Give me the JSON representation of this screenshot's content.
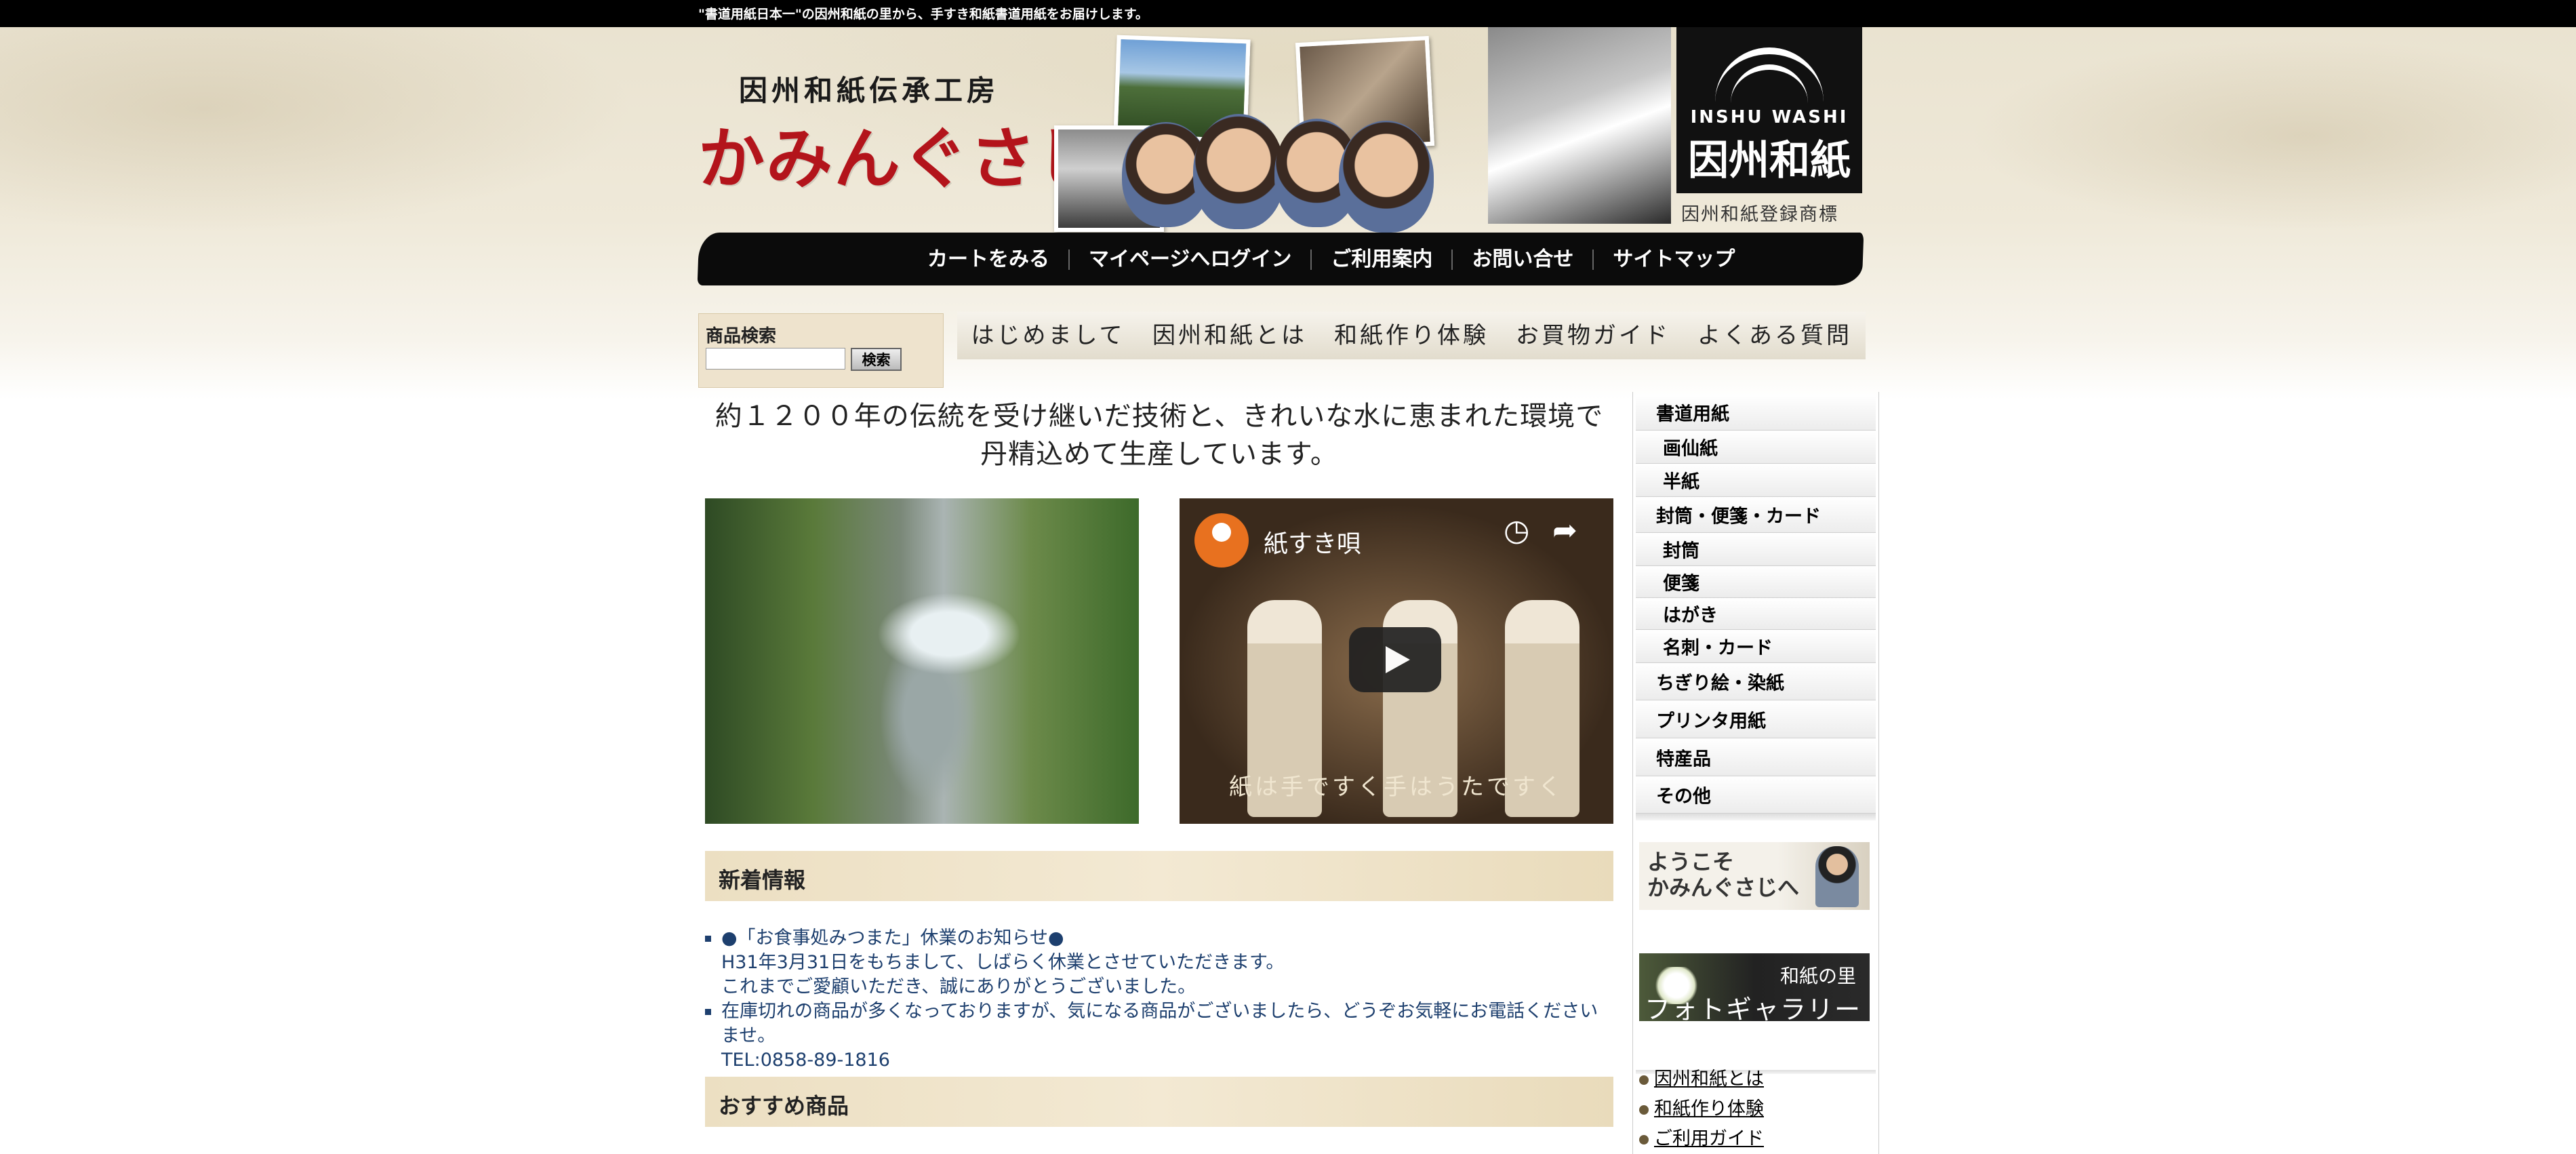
{
  "topbar": {
    "text": "\"書道用紙日本一\"の因州和紙の里から、手すき和紙書道用紙をお届けします。"
  },
  "header": {
    "logo_sub": "因州和紙伝承工房",
    "logo_main": "かみんぐさじ",
    "brand_en": "INSHU WASHI",
    "brand_jp": "因州和紙",
    "brand_caption": "因州和紙登録商標"
  },
  "nav": {
    "items": [
      "カートをみる",
      "マイページへログイン",
      "ご利用案内",
      "お問い合せ",
      "サイトマップ"
    ]
  },
  "search": {
    "title": "商品検索",
    "value": "",
    "button": "検索"
  },
  "tabs": [
    "はじめまして",
    "因州和紙とは",
    "和紙作り体験",
    "お買物ガイド",
    "よくある質問"
  ],
  "main": {
    "tagline_line1": "約１２００年の伝統を受け継いだ技術と、きれいな水に恵まれた環境で",
    "tagline_line2": "丹精込めて生産しています。",
    "video": {
      "title": "紙すき唄",
      "caption": "紙は手ですく手はうたですく"
    },
    "news_heading": "新着情報",
    "news": [
      "●「お食事処みつまた」休業のお知らせ●",
      "H31年3月31日をもちまして、しばらく休業とさせていただきます。",
      "これまでご愛顧いただき、誠にありがとうございました。",
      "在庫切れの商品が多くなっておりますが、気になる商品がございましたら、どうぞお気軽にお電話くださいませ。",
      "TEL:0858-89-1816"
    ],
    "recommend_heading": "おすすめ商品"
  },
  "sidemenu": {
    "items": [
      "書道用紙",
      "画仙紙",
      "半紙",
      "封筒・便箋・カード",
      "封筒",
      "便箋",
      "はがき",
      "名刺・カード",
      "ちぎり絵・染紙",
      "プリンタ用紙",
      "特産品",
      "その他"
    ]
  },
  "banners": {
    "welcome": "ようこそ\nかみんぐさじへ",
    "gallery_small": "和紙の里",
    "gallery_big": "フォトギャラリー"
  },
  "links": [
    "因州和紙とは",
    "和紙作り体験",
    "ご利用ガイド"
  ]
}
